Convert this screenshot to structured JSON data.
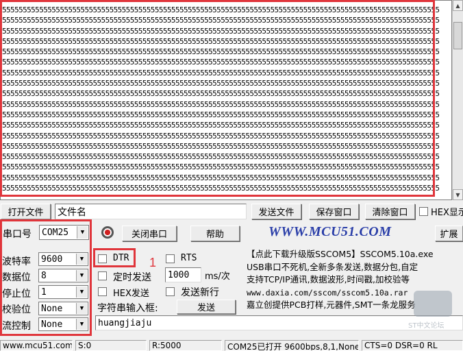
{
  "receive": {
    "line": "5555555555555555555555555555555555555555555555555555555555555555555555555555555555555555555555555555555555",
    "line_count": 18
  },
  "toolbar": {
    "open_file": "打开文件",
    "filename": "文件名",
    "send_file": "发送文件",
    "save_window": "保存窗口",
    "clear_window": "清除窗口",
    "hex_display": "HEX显示"
  },
  "port": {
    "label": "串口号",
    "value": "COM25",
    "close_button": "关闭串口",
    "help_button": "帮助",
    "expand_button": "扩展",
    "logo": "WWW.MCU51.COM"
  },
  "settings": {
    "baud": {
      "label": "波特率",
      "value": "9600"
    },
    "databits": {
      "label": "数据位",
      "value": "8"
    },
    "stopbits": {
      "label": "停止位",
      "value": "1"
    },
    "parity": {
      "label": "校验位",
      "value": "None"
    },
    "flow": {
      "label": "流控制",
      "value": "None"
    }
  },
  "options": {
    "dtr": "DTR",
    "rts": "RTS",
    "timed_send": "定时发送",
    "interval": "1000",
    "interval_unit": "ms/次",
    "hex_send": "HEX发送",
    "send_newline": "发送新行",
    "input_label": "字符串输入框:",
    "send_button": "发送",
    "annotation_number": "1"
  },
  "ad": {
    "line1": "【点此下载升级版SSCOM5】SSCOM5.10a.exe",
    "line2": "USB串口不死机,全新多条发送,数据分包,自定",
    "line3": "支持TCP/IP通讯,数据波形,时间戳,加校验等",
    "line4": "www.daxia.com/sscom/sscom5.10a.rar",
    "line5": "嘉立创提供PCB打样,元器件,SMT一条龙服务"
  },
  "input": {
    "value": "huangjiaju"
  },
  "statusbar": {
    "site": "www.mcu51.com",
    "sent": "S:0",
    "received": "R:5000",
    "port_status": "COM25已打开 9600bps,8,1,None,None",
    "signals": "CTS=0 DSR=0 RL"
  },
  "watermark": "ST中文论坛",
  "colors": {
    "annotation": "#e0353b",
    "logo": "#2a3ea8"
  }
}
